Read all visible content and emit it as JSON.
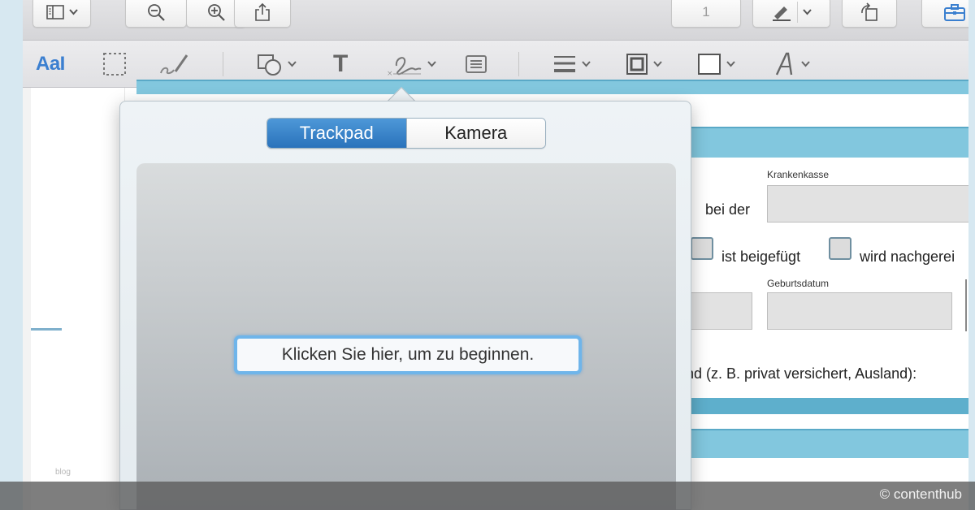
{
  "toolbar": {
    "page_number": "1"
  },
  "markup": {
    "text_style_label": "AaI"
  },
  "document": {
    "label_krankenkasse": "Krankenkasse",
    "label_bei_der": "bei der",
    "label_ist_beigefuegt": "ist beigefügt",
    "label_wird_nachgereicht": "wird nachgerei",
    "label_geburtsdatum": "Geburtsdatum",
    "label_grund": "rund (z. B. privat versichert, Ausland):"
  },
  "signature_popover": {
    "tabs": [
      {
        "label": "Trackpad",
        "active": true
      },
      {
        "label": "Kamera",
        "active": false
      }
    ],
    "start_button": "Klicken Sie hier, um zu beginnen."
  },
  "watermark": {
    "blog": "blog",
    "credit": "© contenthub"
  },
  "colors": {
    "accent": "#2a72bb",
    "form_band": "#82c7de",
    "focus_ring": "#6fb5ea"
  }
}
